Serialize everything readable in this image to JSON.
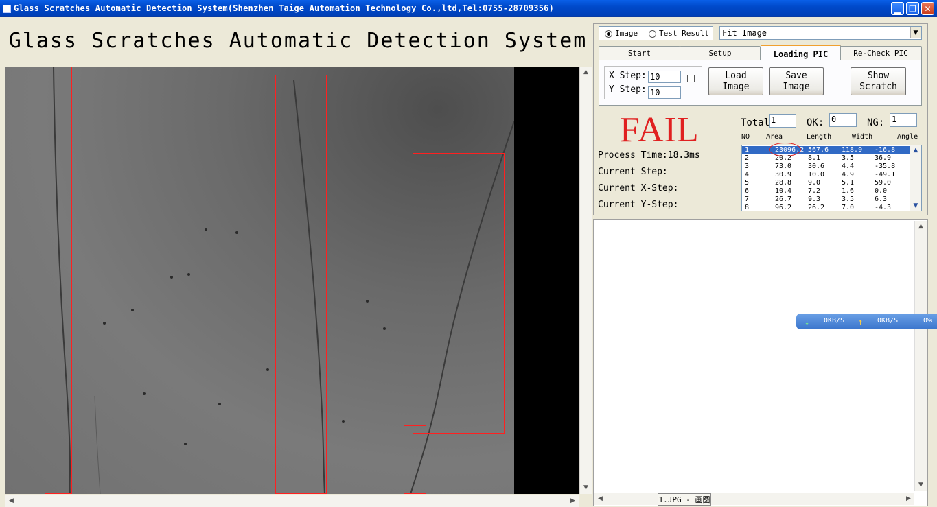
{
  "window": {
    "title": "Glass Scratches Automatic Detection System(Shenzhen Taige Automation Technology Co.,ltd,Tel:0755-28709356)",
    "minimize": "▁",
    "maximize": "❐",
    "close": "✕"
  },
  "heading": "Glass Scratches Automatic Detection System",
  "view": {
    "mode_options": [
      "Image",
      "Test Result"
    ],
    "selected_mode": "Image",
    "fit_select": "Fit Image"
  },
  "tabs": [
    "Start",
    "Setup",
    "Loading PIC",
    "Re-Check PIC"
  ],
  "active_tab": "Loading PIC",
  "loading_pic": {
    "x_step_label": "X Step:",
    "x_step_value": "10",
    "y_step_label": "Y Step:",
    "y_step_value": "10",
    "load_image": "Load Image",
    "save_image": "Save Image",
    "show_scratch": "Show Scratch"
  },
  "result": {
    "status": "FAIL",
    "status_color": "#e02020",
    "process_time": "Process Time:18.3ms",
    "current_step": "Current Step:",
    "current_x_step": "Current X-Step:",
    "current_y_step": "Current Y-Step:",
    "total_label": "Total",
    "total_value": "1",
    "ok_label": "OK:",
    "ok_value": "0",
    "ng_label": "NG:",
    "ng_value": "1"
  },
  "table": {
    "columns": [
      "NO",
      "Area",
      "Length",
      "Width",
      "Angle"
    ],
    "rows": [
      [
        "1",
        "23096.2",
        "567.6",
        "118.9",
        "-16.8"
      ],
      [
        "2",
        "20.2",
        "8.1",
        "3.5",
        "36.9"
      ],
      [
        "3",
        "73.0",
        "30.6",
        "4.4",
        "-35.8"
      ],
      [
        "4",
        "30.9",
        "10.0",
        "4.9",
        "-49.1"
      ],
      [
        "5",
        "28.8",
        "9.0",
        "5.1",
        "59.0"
      ],
      [
        "6",
        "10.4",
        "7.2",
        "1.6",
        "0.0"
      ],
      [
        "7",
        "26.7",
        "9.3",
        "3.5",
        "6.3"
      ],
      [
        "8",
        "96.2",
        "26.2",
        "7.0",
        "-4.3"
      ]
    ],
    "selected_row": 0
  },
  "taskbar_item": "1.JPG - 画图",
  "netspeed": {
    "down": "0KB/S",
    "up": "0KB/S",
    "percent": "0%"
  }
}
